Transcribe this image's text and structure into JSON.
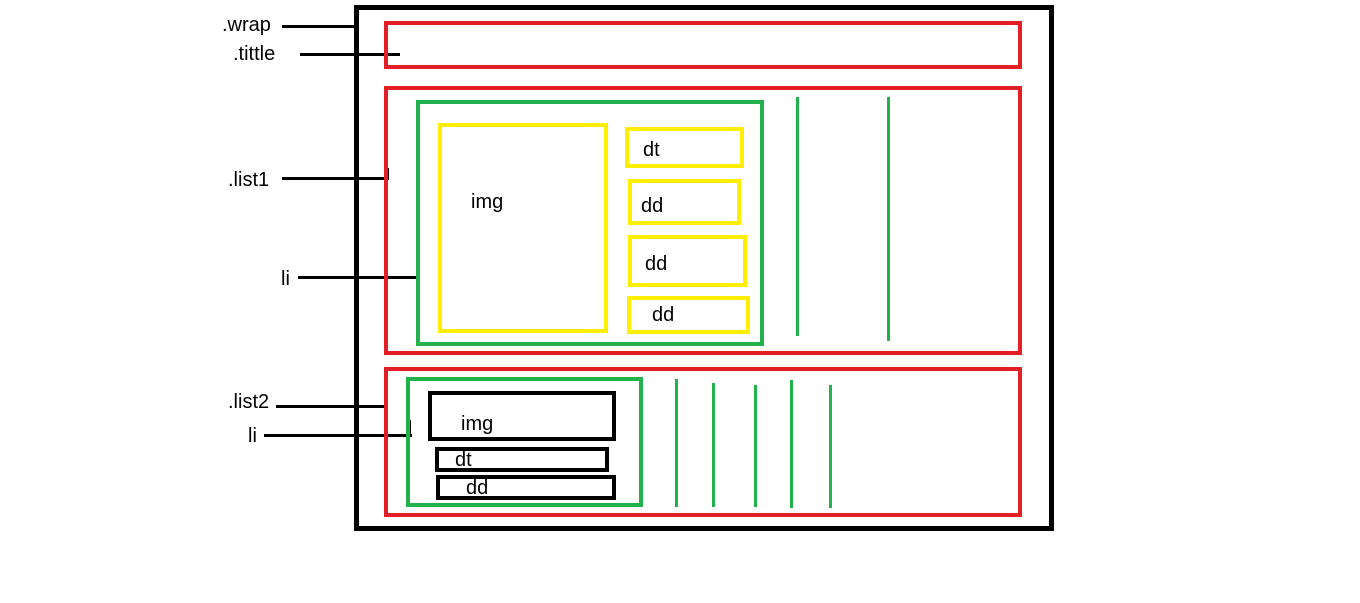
{
  "labels": {
    "wrap": ".wrap",
    "title": ".tittle",
    "list1": ".list1",
    "li1": "li",
    "list2": ".list2",
    "li2": "li"
  },
  "list1_item": {
    "img": "img",
    "dt": "dt",
    "dd": [
      "dd",
      "dd",
      "dd"
    ]
  },
  "list2_item": {
    "img": "img",
    "dt": "dt",
    "dd": "dd"
  },
  "colors": {
    "wrap": "#000000",
    "section": "#e31e24",
    "item": "#22b14c",
    "list1_field": "#ffee00",
    "list2_field": "#000000"
  }
}
